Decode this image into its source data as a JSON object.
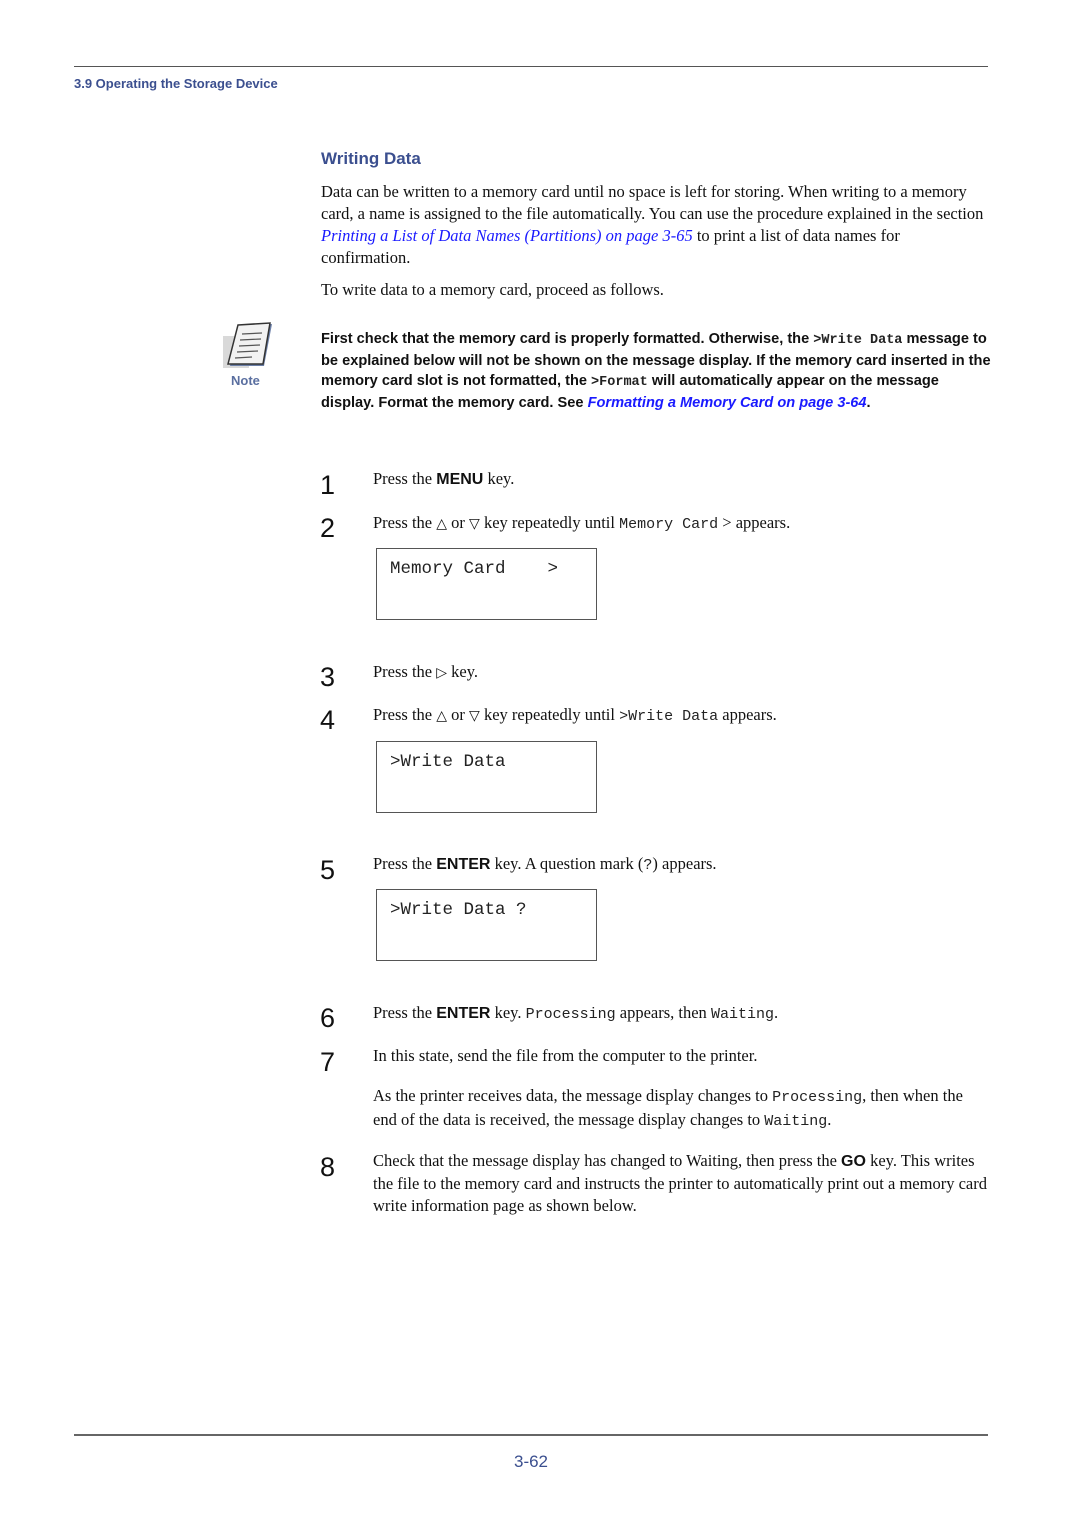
{
  "header": {
    "section": "3.9 Operating the Storage Device"
  },
  "title": "Writing Data",
  "intro": {
    "p1_before": "Data can be written to a memory card until no space is left for storing. When writing to a memory card, a name is assigned to the file automatically. You can use the procedure explained in the section ",
    "p1_link": "Printing a List of Data Names (Partitions) on page 3-65",
    "p1_after": " to print a list of data names for confirmation.",
    "p2": "To write data to a memory card, proceed as follows."
  },
  "note": {
    "label": "Note",
    "icon": "note-pad-icon",
    "text_1": "First check that the memory card is properly formatted. Otherwise, the ",
    "code_1": ">Write Data",
    "text_2": " message to be explained below will not be shown on the message display. If the memory card inserted in the memory card slot is not formatted, the ",
    "code_2": ">Format",
    "text_3": " will automatically appear on the message display. Format the memory card. See ",
    "link": "Formatting a Memory Card on page 3-64",
    "text_4": "."
  },
  "symbols": {
    "up": "△",
    "down": "▽",
    "right": "▷"
  },
  "steps": [
    {
      "num": "1",
      "a": "Press the ",
      "key": "MENU",
      "b": " key."
    },
    {
      "num": "2",
      "a": "Press the ",
      "or": " or ",
      "b": " key repeatedly until ",
      "code": "Memory Card",
      "c": " > appears."
    },
    {
      "num": "3",
      "a": "Press the ",
      "b": " key."
    },
    {
      "num": "4",
      "a": "Press the ",
      "or": " or ",
      "b": " key repeatedly until ",
      "code": ">Write Data",
      "c": " appears."
    },
    {
      "num": "5",
      "a": "Press the ",
      "key": "ENTER",
      "b": " key. A question mark (",
      "code": "?",
      "c": ") appears."
    },
    {
      "num": "6",
      "a": "Press the ",
      "key": "ENTER",
      "b": " key. ",
      "code": "Processing",
      "c": " appears, then ",
      "code2": "Waiting",
      "d": "."
    },
    {
      "num": "7",
      "a": "In this state, send the file from the computer to the printer.",
      "sub_a": "As the printer receives data, the message display changes to ",
      "sub_code": "Processing",
      "sub_b": ", then when the end of the data is received, the message display changes to ",
      "sub_code2": "Waiting",
      "sub_c": "."
    },
    {
      "num": "8",
      "a": "Check that the message display has changed to Waiting, then press the ",
      "key": "GO",
      "b": " key. This writes the file to the memory card and instructs the printer to automatically print out a memory card write information page as shown below."
    }
  ],
  "displays": [
    {
      "line1": "Memory Card    >",
      "line2": ""
    },
    {
      "line1": ">Write Data",
      "line2": ""
    },
    {
      "line1": ">Write Data ?",
      "line2": ""
    }
  ],
  "footer": {
    "page_number": "3-62"
  },
  "colors": {
    "heading": "#3b4f8f",
    "link": "#1a1aff"
  }
}
